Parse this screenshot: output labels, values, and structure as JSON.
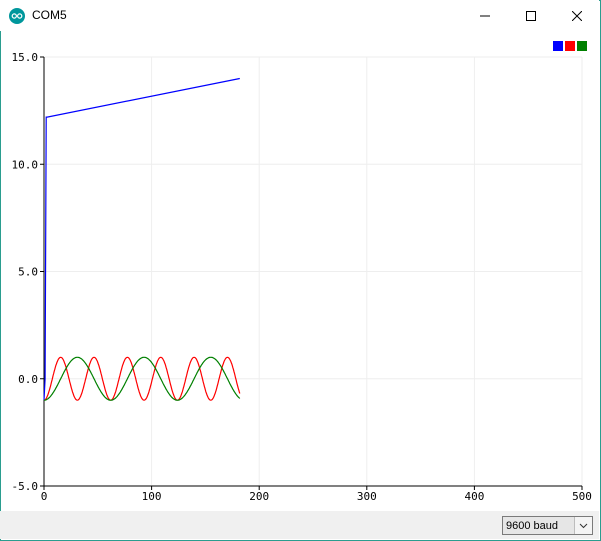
{
  "window": {
    "title": "COM5"
  },
  "chart_data": {
    "type": "line",
    "xlim": [
      0,
      500
    ],
    "ylim": [
      -5.0,
      15.0
    ],
    "xticks": [
      "0",
      "100",
      "200",
      "300",
      "400",
      "500"
    ],
    "yticks": [
      "15.0",
      "10.0",
      "5.0",
      "0.0",
      "-5.0"
    ],
    "grid": true,
    "legend_position": "top-right",
    "series": [
      {
        "color": "#0000ff",
        "x": [
          0,
          1,
          2,
          3,
          182
        ],
        "y": [
          -1.0,
          0.0,
          12.2,
          12.2,
          14.0
        ]
      },
      {
        "color": "#ff0000",
        "type": "sine",
        "amplitude": 1.0,
        "period": 31,
        "phase": -1.5708,
        "x_start": 0,
        "x_end": 182
      },
      {
        "color": "#008000",
        "type": "sine",
        "amplitude": 1.0,
        "period": 62,
        "phase": -1.5708,
        "x_start": 0,
        "x_end": 182
      }
    ]
  },
  "legend": {
    "colors": [
      "#0000ff",
      "#ff0000",
      "#008000"
    ]
  },
  "statusbar": {
    "baud": "9600 baud"
  }
}
